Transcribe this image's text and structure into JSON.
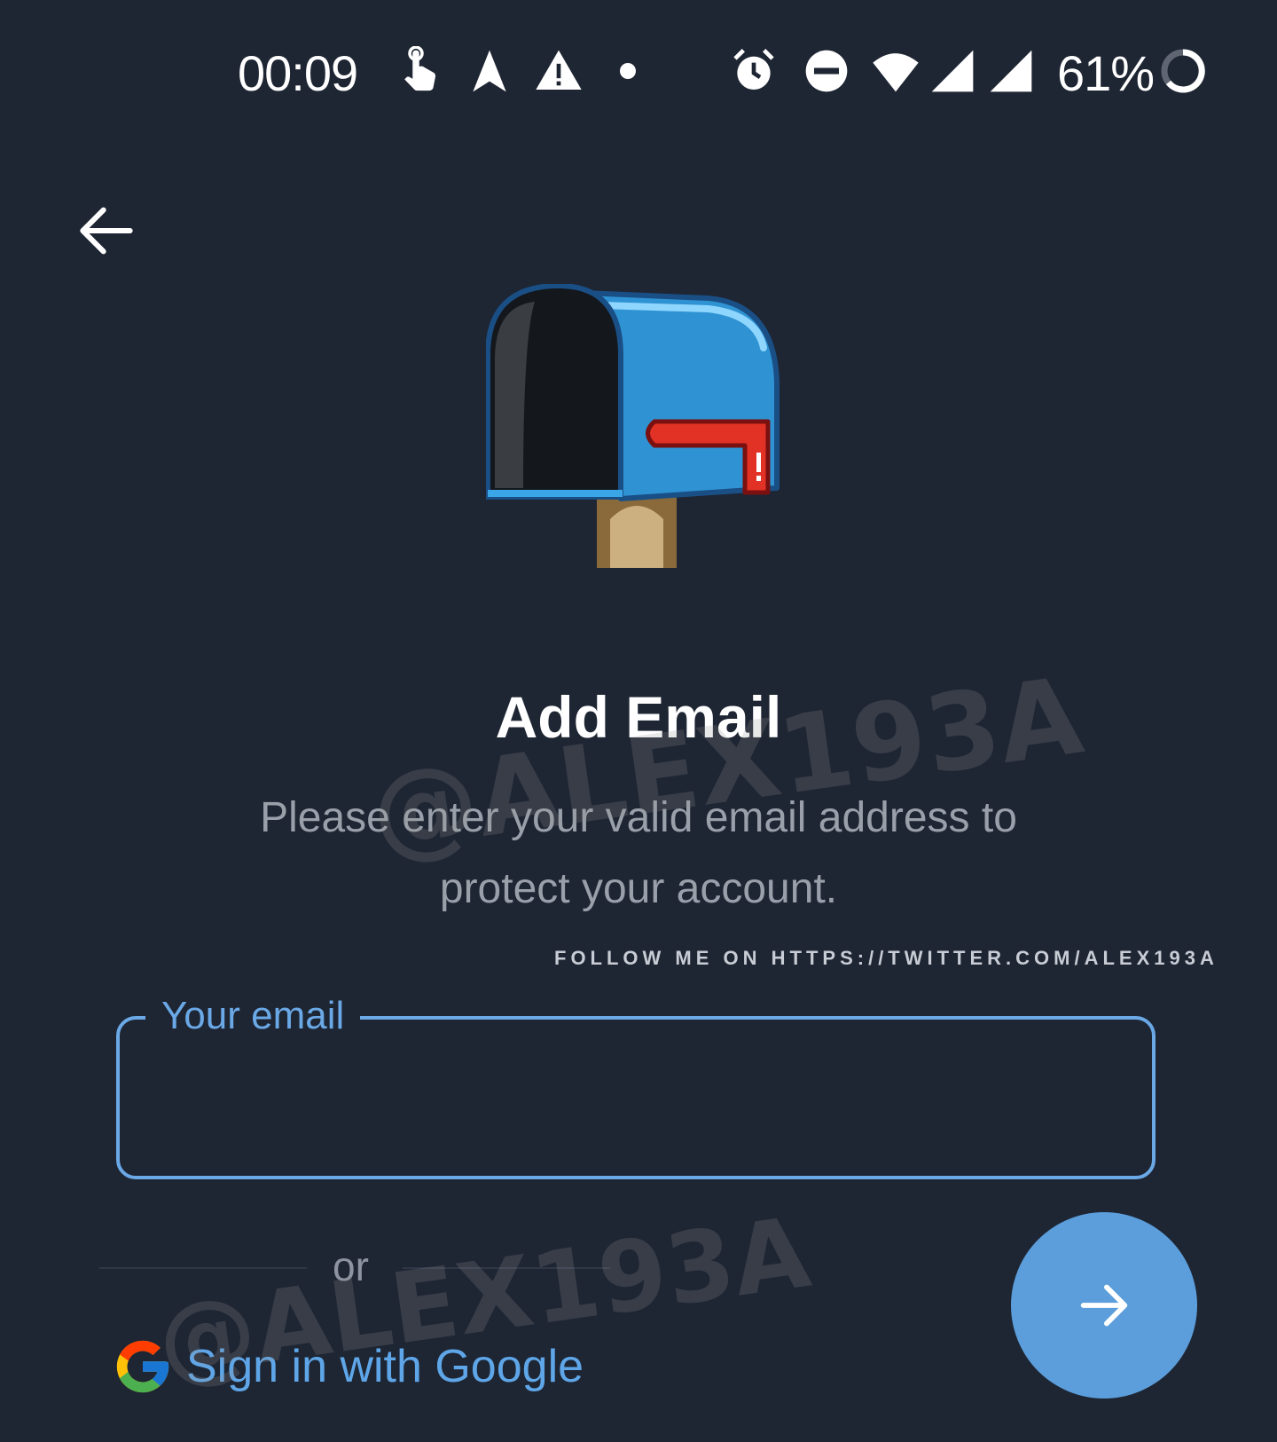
{
  "status_bar": {
    "time": "00:09",
    "battery": "61%",
    "icons": [
      "touch-icon",
      "navigation-icon",
      "warning-icon",
      "dot-icon",
      "alarm-icon",
      "do-not-disturb-icon",
      "wifi-icon",
      "signal-icon",
      "signal-icon",
      "battery-ring-icon"
    ]
  },
  "header": {
    "back_icon": "arrow-left-icon"
  },
  "hero": {
    "icon": "mailbox-icon"
  },
  "content": {
    "title": "Add Email",
    "subtitle": "Please enter your valid email address to protect your account."
  },
  "watermark": {
    "text": "@ALEX193A",
    "follow": "FOLLOW ME ON HTTPS://TWITTER.COM/ALEX193A"
  },
  "email": {
    "label": "Your email",
    "value": ""
  },
  "divider": {
    "text": "or"
  },
  "google": {
    "label": "Sign in with Google",
    "icon": "google-logo-icon"
  },
  "next_button": {
    "icon": "arrow-right-icon"
  },
  "colors": {
    "background": "#1e2533",
    "accent": "#5b9edb",
    "field_border": "#6aa8e6"
  }
}
